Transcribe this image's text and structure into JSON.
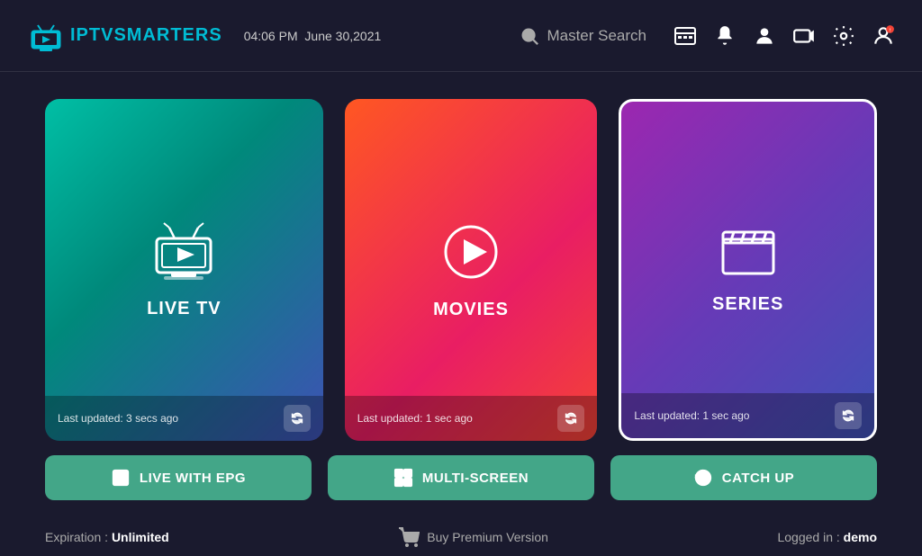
{
  "header": {
    "logo_iptv": "IPTV",
    "logo_smarters": "SMARTERS",
    "time": "04:06 PM",
    "date": "June 30,2021",
    "search_label": "Master Search"
  },
  "cards": {
    "live_tv": {
      "title": "LIVE TV",
      "footer": "Last updated: 3 secs ago"
    },
    "movies": {
      "title": "MOVIES",
      "footer": "Last updated: 1 sec ago"
    },
    "series": {
      "title": "SERIES",
      "footer": "Last updated: 1 sec ago"
    }
  },
  "buttons": {
    "live_epg": "LIVE WITH EPG",
    "multi_screen": "MULTI-SCREEN",
    "catch_up": "CATCH UP"
  },
  "bottom": {
    "expiration_label": "Expiration : ",
    "expiration_value": "Unlimited",
    "buy_label": "Buy Premium Version",
    "logged_label": "Logged in : ",
    "logged_value": "demo"
  }
}
